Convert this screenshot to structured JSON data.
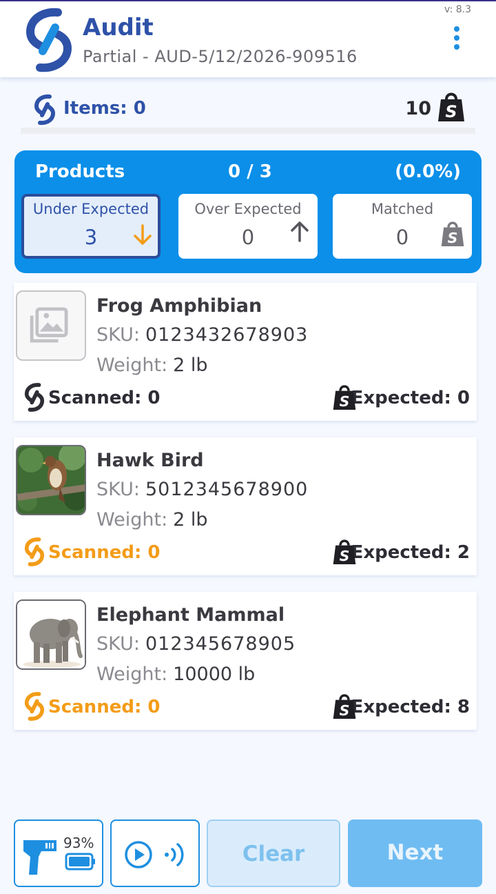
{
  "header": {
    "title": "Audit",
    "subtitle": "Partial - AUD-5/12/2026-909516",
    "version": "v: 8.3",
    "menu_icon": "kebab-menu-icon"
  },
  "items_bar": {
    "label": "Items: 0",
    "count": "10"
  },
  "summary": {
    "title": "Products",
    "ratio": "0 / 3",
    "percent": "(0.0%)",
    "stats": [
      {
        "label": "Under Expected",
        "value": "3",
        "icon": "arrow-down-icon",
        "active": true
      },
      {
        "label": "Over Expected",
        "value": "0",
        "icon": "arrow-up-icon",
        "active": false
      },
      {
        "label": "Matched",
        "value": "0",
        "icon": "shopping-bag-icon",
        "active": false
      }
    ]
  },
  "products": [
    {
      "name": "Frog Amphibian",
      "sku_label": "SKU:",
      "sku": "0123432678903",
      "weight_label": "Weight:",
      "weight": "2 lb",
      "scanned": "Scanned: 0",
      "expected": "Expected: 0",
      "scanned_color": "#2d2d35",
      "image": "image-placeholder-icon"
    },
    {
      "name": "Hawk Bird",
      "sku_label": "SKU:",
      "sku": "5012345678900",
      "weight_label": "Weight:",
      "weight": "2 lb",
      "scanned": "Scanned: 0",
      "expected": "Expected: 2",
      "scanned_color": "#f39c18",
      "image": "hawk-photo"
    },
    {
      "name": "Elephant Mammal",
      "sku_label": "SKU:",
      "sku": "012345678905",
      "weight_label": "Weight:",
      "weight": "10000 lb",
      "scanned": "Scanned: 0",
      "expected": "Expected: 8",
      "scanned_color": "#f39c18",
      "image": "elephant-photo"
    }
  ],
  "footer": {
    "battery": "93%",
    "clear_label": "Clear",
    "next_label": "Next"
  },
  "colors": {
    "brand_blue": "#2e52a8",
    "accent_blue": "#0b8fe9",
    "scanned_orange": "#f39c18"
  }
}
